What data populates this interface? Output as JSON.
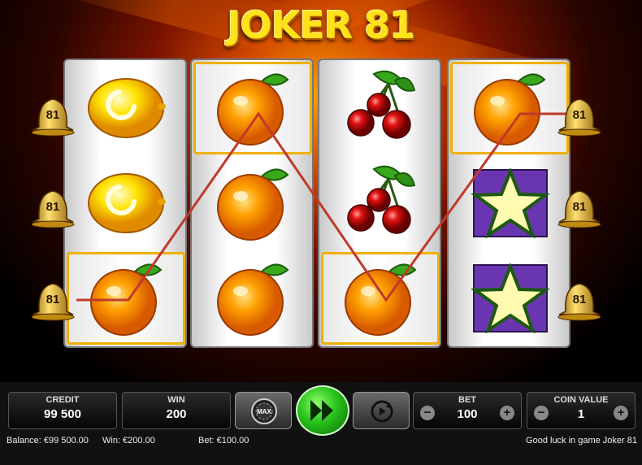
{
  "game": {
    "title": "JOKER 81"
  },
  "reels": [
    [
      "lemon",
      "lemon",
      "orange"
    ],
    [
      "orange",
      "orange",
      "orange"
    ],
    [
      "cherry",
      "cherry",
      "orange"
    ],
    [
      "orange",
      "star",
      "star"
    ]
  ],
  "bell_label": "81",
  "panel": {
    "credit_label": "CREDIT",
    "credit_value": "99 500",
    "win_label": "WIN",
    "win_value": "200",
    "max_label": "MAX",
    "bet_label": "BET",
    "bet_value": "100",
    "coin_label": "COIN VALUE",
    "coin_value": "1",
    "minus": "−",
    "plus": "+"
  },
  "status": {
    "balance": "Balance: €99 500.00",
    "win": "Win: €200.00",
    "bet": "Bet: €100.00",
    "message": "Good luck in game Joker 81"
  },
  "colors": {
    "payline": "#c0392b",
    "win_frame": "#f0b000",
    "spin": "#27c21a"
  }
}
